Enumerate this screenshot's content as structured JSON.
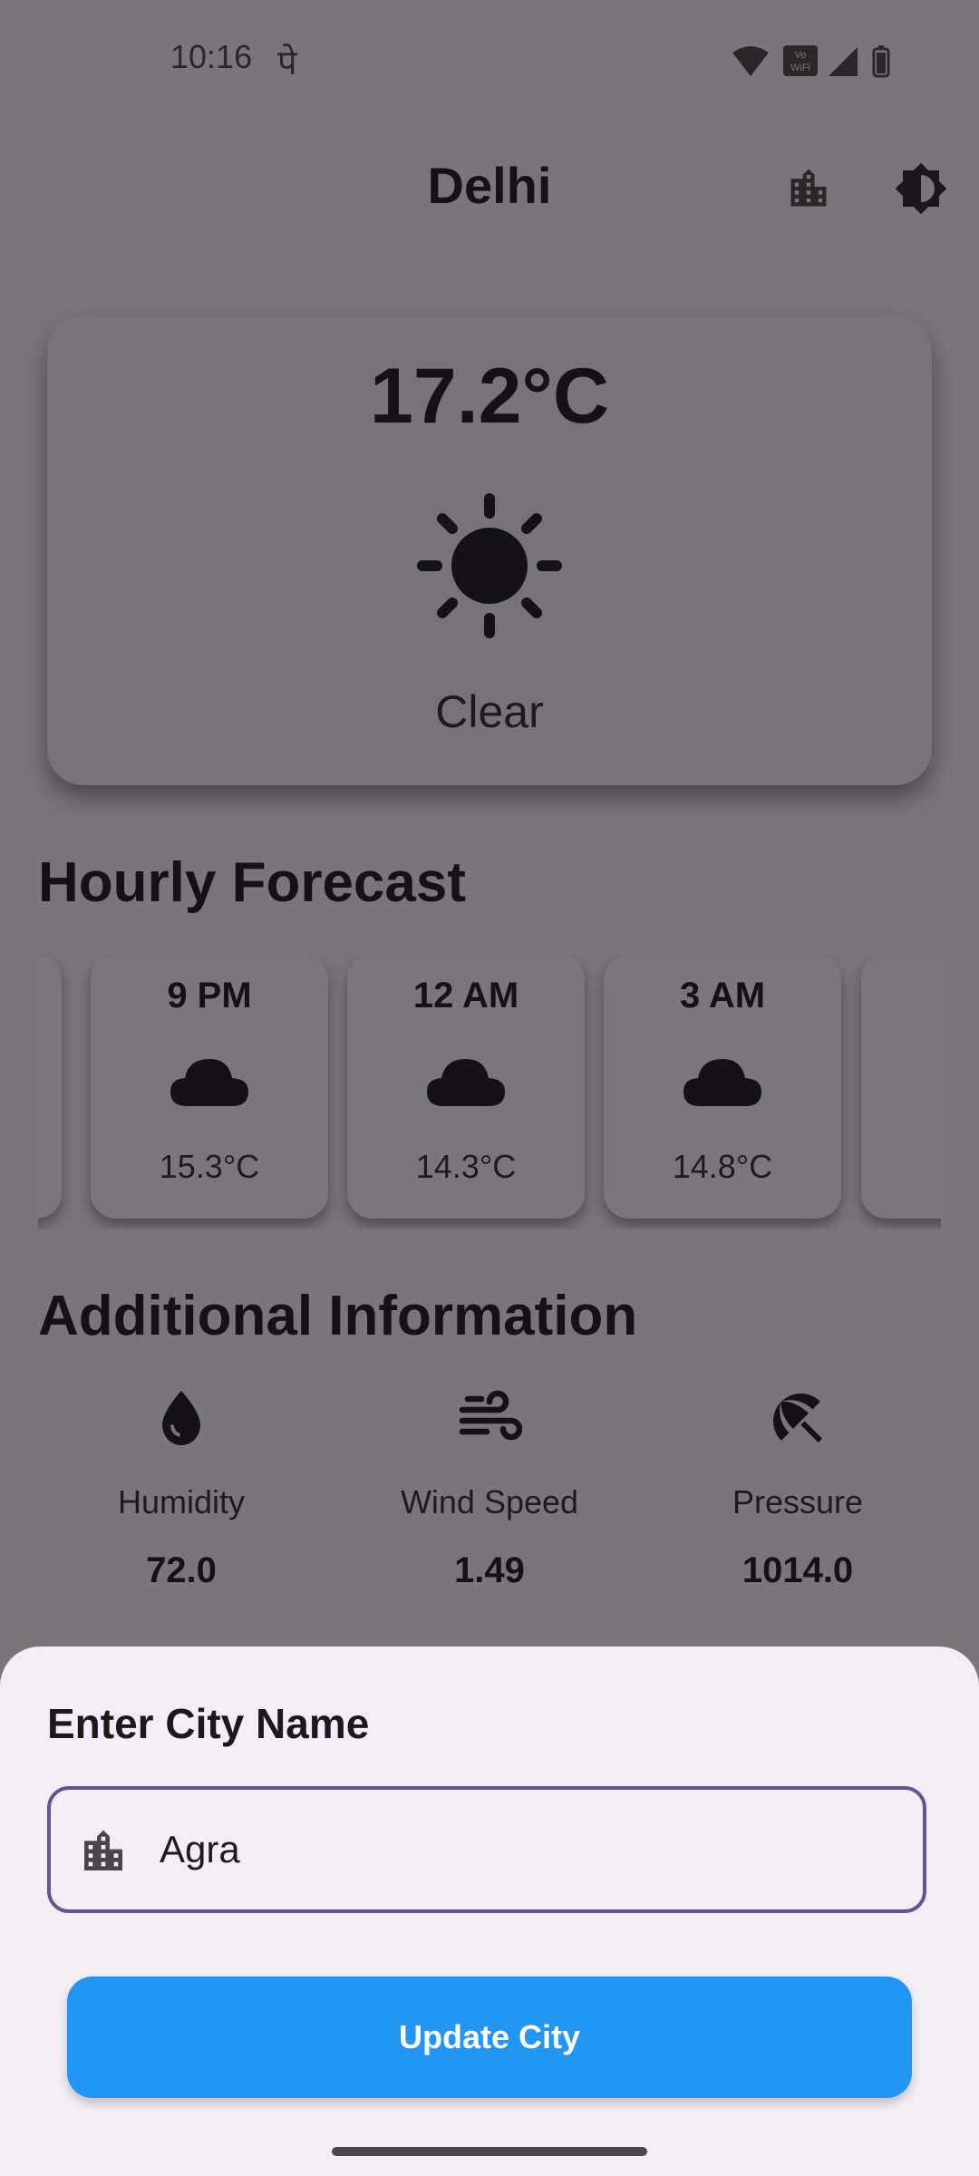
{
  "status_bar": {
    "time": "10:16",
    "extra_glyph": "पे",
    "icons": [
      "wifi-icon",
      "vowifi-icon",
      "signal-icon",
      "battery-icon"
    ]
  },
  "app_bar": {
    "title": "Delhi",
    "actions": [
      "city-icon",
      "brightness-icon"
    ]
  },
  "current": {
    "temperature": "17.2°C",
    "condition_icon": "sun-icon",
    "condition": "Clear"
  },
  "hourly": {
    "heading": "Hourly Forecast",
    "items": [
      {
        "time": "9 PM",
        "icon": "cloud-icon",
        "temp": "15.3°C"
      },
      {
        "time": "12 AM",
        "icon": "cloud-icon",
        "temp": "14.3°C"
      },
      {
        "time": "3 AM",
        "icon": "cloud-icon",
        "temp": "14.8°C"
      }
    ]
  },
  "additional": {
    "heading": "Additional Information",
    "items": [
      {
        "icon": "water-drop-icon",
        "label": "Humidity",
        "value": "72.0"
      },
      {
        "icon": "wind-icon",
        "label": "Wind Speed",
        "value": "1.49"
      },
      {
        "icon": "beach-umbrella-icon",
        "label": "Pressure",
        "value": "1014.0"
      }
    ]
  },
  "sheet": {
    "title": "Enter City Name",
    "input_value": "Agra",
    "button_label": "Update City"
  },
  "colors": {
    "scrim_background": "#7a7579",
    "sheet_background": "#f3eef6",
    "field_border": "#65558f",
    "button": "#2196f3"
  }
}
